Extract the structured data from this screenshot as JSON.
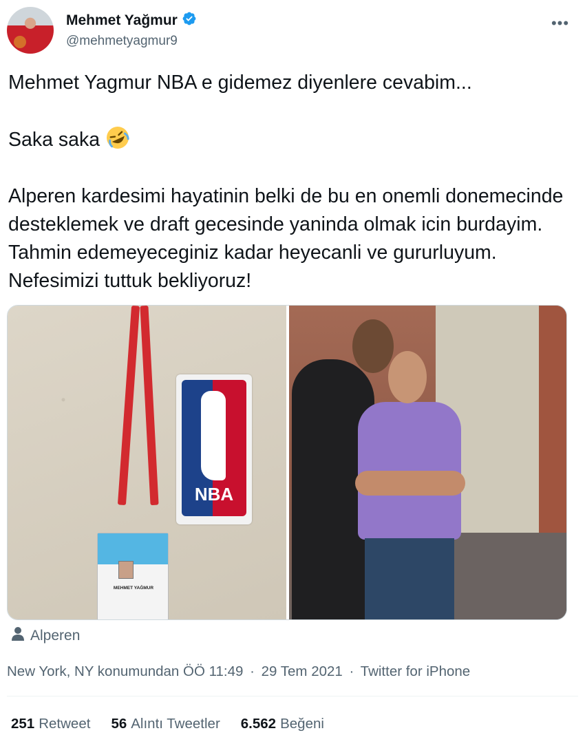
{
  "author": {
    "display_name": "Mehmet Yağmur",
    "handle": "@mehmetyagmur9",
    "verified": true,
    "verified_color": "#1d9bf0"
  },
  "more_icon": "more-horizontal-icon",
  "tweet_text": {
    "para1": "Mehmet Yagmur NBA e gidemez diyenlere cevabim...",
    "para2": "Saka saka",
    "para2_emoji": "rolling-on-the-floor-laughing-emoji",
    "para3": "Alperen kardesimi hayatinin belki de bu en onemli donemecinde desteklemek ve draft gecesinde yaninda olmak icin burdayim. Tahmin edemeyeceginiz kadar heyecanli ve gururluyum. Nefesimizi tuttuk bekliyoruz!"
  },
  "media": {
    "photo_left": {
      "badge_name": "MEHMET YAĞMUR",
      "logo_text": "NBA"
    }
  },
  "tagged_user": "Alperen",
  "meta": {
    "location": "New York, NY konumundan",
    "time": "ÖÖ 11:49",
    "date": "29 Tem 2021",
    "source": "Twitter for iPhone",
    "separator": "·"
  },
  "stats": {
    "retweets_count": "251",
    "retweets_label": "Retweet",
    "quotes_count": "56",
    "quotes_label": "Alıntı Tweetler",
    "likes_count": "6.562",
    "likes_label": "Beğeni"
  },
  "colors": {
    "text_primary": "#0f1419",
    "text_secondary": "#536471",
    "border": "#eff3f4"
  }
}
